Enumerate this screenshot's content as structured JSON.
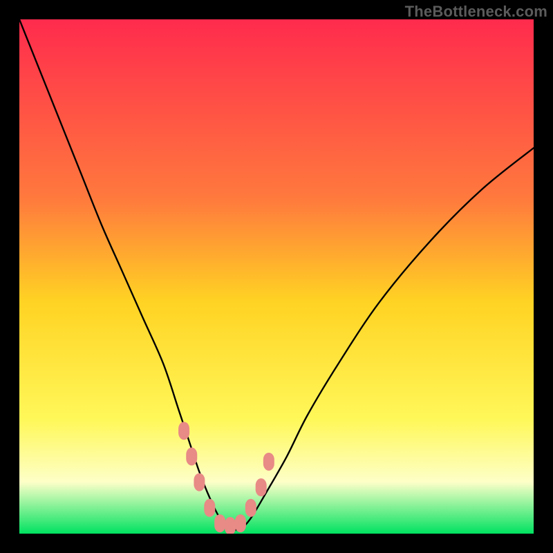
{
  "watermark": "TheBottleneck.com",
  "colors": {
    "frame": "#000000",
    "gradient_top": "#ff2b4d",
    "gradient_mid_upper": "#ff7a3d",
    "gradient_mid": "#ffd323",
    "gradient_mid_lower": "#fff85a",
    "gradient_pale": "#fdffc8",
    "gradient_bottom": "#00e261",
    "curve_stroke": "#000000",
    "marker_fill": "#e88a86",
    "marker_stroke": "#b25a56"
  },
  "chart_data": {
    "type": "line",
    "title": "",
    "xlabel": "",
    "ylabel": "",
    "xlim": [
      0,
      100
    ],
    "ylim": [
      0,
      100
    ],
    "series": [
      {
        "name": "bottleneck-curve",
        "x": [
          0,
          4,
          8,
          12,
          16,
          20,
          24,
          28,
          31,
          33,
          35,
          37,
          39,
          41,
          43,
          45,
          48,
          52,
          56,
          62,
          70,
          80,
          90,
          100
        ],
        "y": [
          100,
          90,
          80,
          70,
          60,
          51,
          42,
          33,
          24,
          18,
          12,
          7,
          3,
          1,
          1,
          3,
          8,
          15,
          23,
          33,
          45,
          57,
          67,
          75
        ]
      }
    ],
    "markers": {
      "name": "highlight-points",
      "x": [
        32,
        33.5,
        35,
        37,
        39,
        41,
        43,
        45,
        47,
        48.5
      ],
      "y": [
        20,
        15,
        10,
        5,
        2,
        1.5,
        2,
        5,
        9,
        14
      ]
    }
  }
}
